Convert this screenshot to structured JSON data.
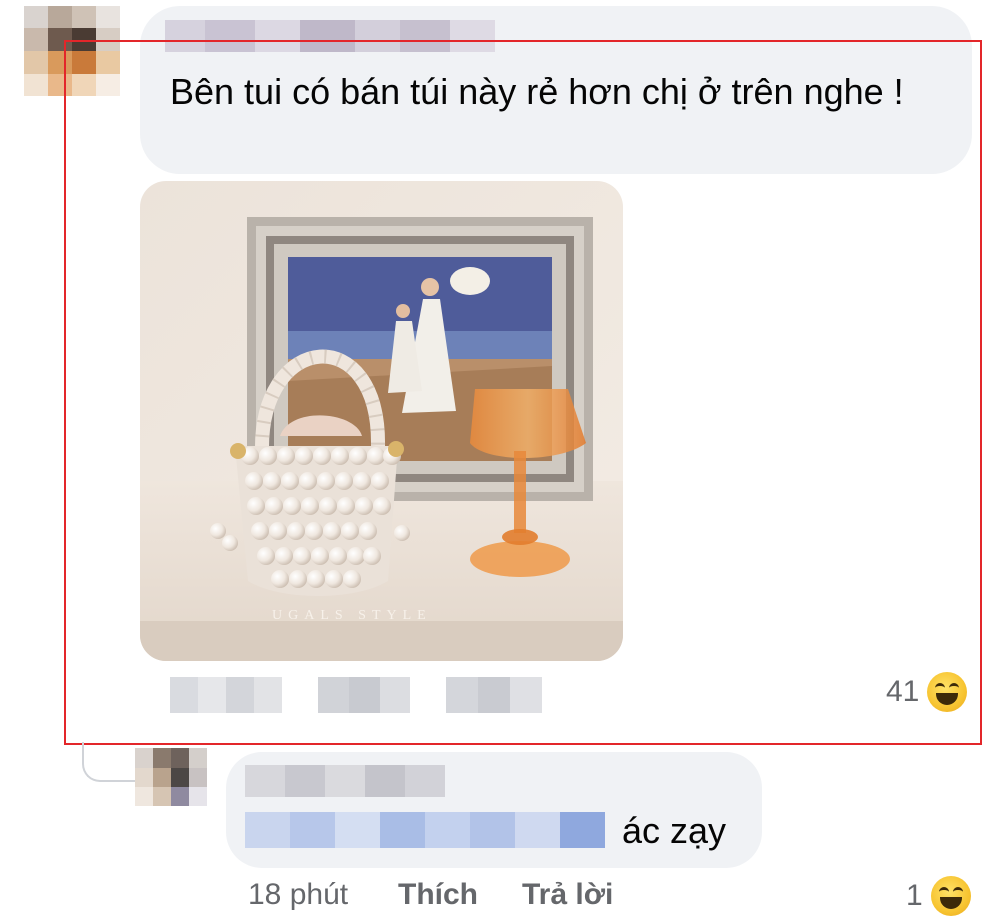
{
  "comment": {
    "text": "Bên tui có bán túi này rẻ hơn chị ở trên nghe !",
    "photo_watermark": "UGALS STYLE",
    "reaction_count": "41",
    "reaction_icon": "haha-emoji-icon"
  },
  "reply": {
    "text_suffix": "ác zạy",
    "time": "18 phút",
    "like_label": "Thích",
    "reply_label": "Trả lời",
    "reaction_count": "1",
    "reaction_icon": "haha-emoji-icon"
  },
  "colors": {
    "bubble": "#f0f2f5",
    "highlight_border": "#e3262a",
    "meta_text": "#65676b",
    "link_blue": "#6f8fd6"
  }
}
